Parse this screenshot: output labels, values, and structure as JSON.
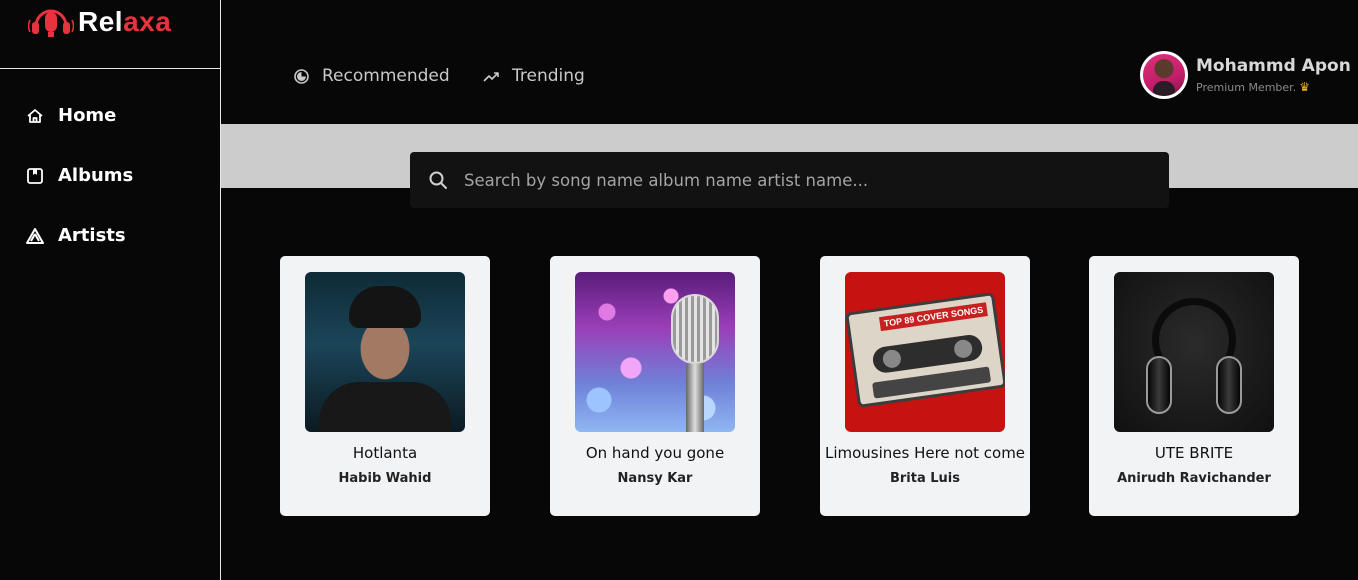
{
  "brand": {
    "name_part1": "Rel",
    "name_part2": "axa"
  },
  "sidebar": {
    "items": [
      {
        "label": "Home",
        "icon": "home-icon"
      },
      {
        "label": "Albums",
        "icon": "album-icon"
      },
      {
        "label": "Artists",
        "icon": "artist-icon"
      }
    ]
  },
  "header": {
    "tabs": [
      {
        "label": "Recommended",
        "icon": "recommended-icon"
      },
      {
        "label": "Trending",
        "icon": "trending-icon"
      }
    ],
    "user": {
      "name": "Mohammd Apon",
      "membership": "Premium Member.",
      "badge_icon": "crown-icon"
    }
  },
  "search": {
    "placeholder": "Search by song name album name artist name...",
    "value": ""
  },
  "cards": [
    {
      "title": "Hotlanta",
      "artist": "Habib Wahid"
    },
    {
      "title": "On hand you gone",
      "artist": "Nansy Kar"
    },
    {
      "title": "Limousines Here not come",
      "artist": "Brita Luis"
    },
    {
      "title": "UTE BRITE",
      "artist": "Anirudh Ravichander"
    }
  ],
  "colors": {
    "accent": "#e8323e",
    "background": "#070707",
    "card": "#f2f3f5",
    "banner": "#cccccc"
  }
}
